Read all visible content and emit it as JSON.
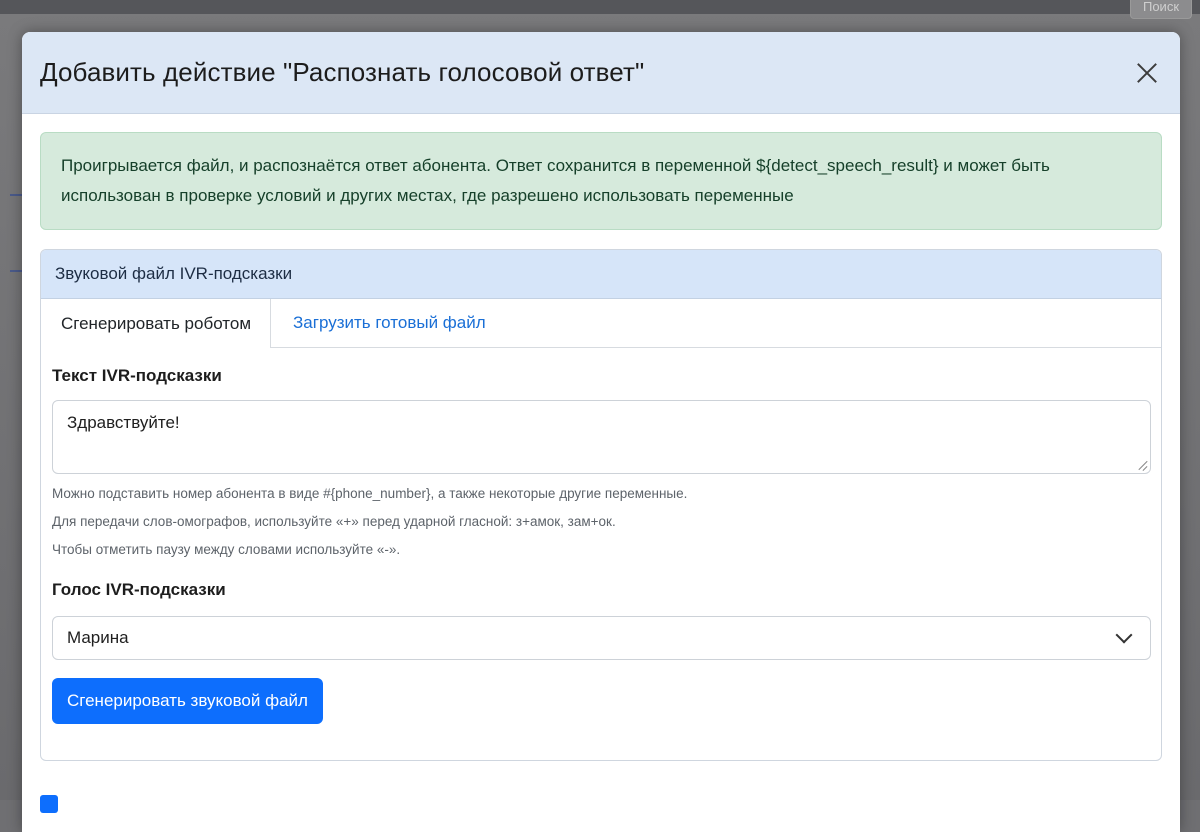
{
  "background": {
    "search_partial": "Поиск"
  },
  "modal": {
    "title": "Добавить действие \"Распознать голосовой ответ\"",
    "info": "Проигрывается файл, и распознаётся ответ абонента. Ответ сохранится в переменной ${detect_speech_result} и может быть использован в проверке условий и других местах, где разрешено использовать переменные"
  },
  "card": {
    "header": "Звуковой файл IVR-подсказки",
    "tabs": [
      "Сгенерировать роботом",
      "Загрузить готовый файл"
    ],
    "text_label": "Текст IVR-подсказки",
    "text_value": "Здравствуйте!",
    "hints": [
      "Можно подставить номер абонента в виде #{phone_number}, а также некоторые другие переменные.",
      "Для передачи слов-омографов, используйте «+» перед ударной гласной: з+амок, зам+ок.",
      "Чтобы отметить паузу между словами используйте «-»."
    ],
    "voice_label": "Голос IVR-подсказки",
    "voice_value": "Марина",
    "generate_button": "Сгенерировать звуковой файл"
  },
  "colors": {
    "accent": "#0d6efd",
    "header_bg": "#dce7f5",
    "alert_bg": "#d6eadc",
    "card_header_bg": "#d6e5f9"
  },
  "icons": {
    "close": "close-icon",
    "dropdown": "chevron-down-icon",
    "resize": "resize-handle-icon"
  }
}
